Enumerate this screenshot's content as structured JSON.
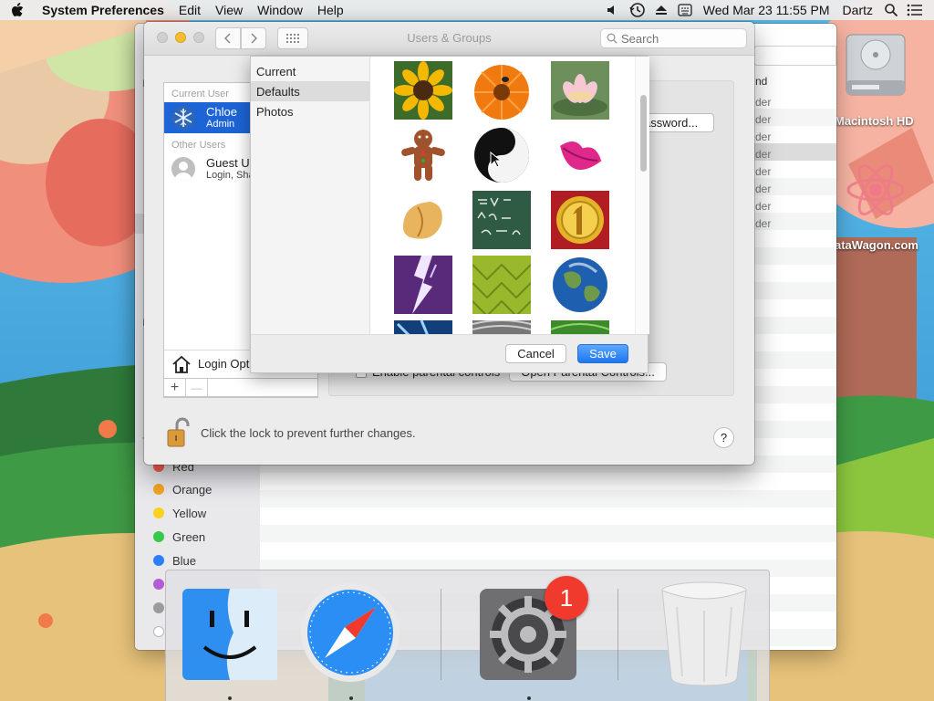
{
  "menubar": {
    "app_name": "System Preferences",
    "items": [
      "Edit",
      "View",
      "Window",
      "Help"
    ],
    "clock": "Wed Mar 23  11:55 PM",
    "user": "Dartz",
    "icons": [
      "apple-icon",
      "volume-icon",
      "time-machine-icon",
      "eject-icon",
      "keyboard-input-icon",
      "spotlight-icon",
      "notification-center-icon"
    ]
  },
  "desktop": {
    "hd_label": "Macintosh HD",
    "wagon_label": "ataWagon.com"
  },
  "finder": {
    "kind_header": "nd",
    "kind_cells": [
      "der",
      "der",
      "der",
      "der",
      "der",
      "der",
      "der",
      "der"
    ],
    "tags": [
      {
        "name": "Red",
        "color": "#fc5c52"
      },
      {
        "name": "Orange",
        "color": "#f5a623"
      },
      {
        "name": "Yellow",
        "color": "#f8d21c"
      },
      {
        "name": "Green",
        "color": "#38c94a"
      },
      {
        "name": "Blue",
        "color": "#2d7ff9"
      },
      {
        "name": "",
        "color": "#b45cd8"
      },
      {
        "name": "",
        "color": "#9b9b9b"
      },
      {
        "name": "",
        "color": "#ffffff"
      }
    ],
    "side_letters": [
      "P",
      "I",
      "T"
    ]
  },
  "prefs": {
    "title": "Users & Groups",
    "search_placeholder": "Search",
    "current_user_header": "Current User",
    "current_user_name": "Chloe",
    "current_user_role": "Admin",
    "other_users_header": "Other Users",
    "guest_name": "Guest Us",
    "guest_sub": "Login, Sha",
    "login_options": "Login Opt",
    "add_label": "+",
    "remove_label": "—",
    "password_button": "assword...",
    "parental_checkbox": "Enable parental controls",
    "parental_button": "Open Parental Controls...",
    "lock_text": "Click the lock to prevent further changes.",
    "help_label": "?"
  },
  "picker": {
    "categories": [
      "Current",
      "Defaults",
      "Photos"
    ],
    "selected_category": "Defaults",
    "pictures": [
      "sunflower",
      "orange-daisy-bee",
      "lotus",
      "gingerbread-man",
      "yin-yang",
      "lips",
      "fortune-cookie",
      "chalkboard",
      "gold-medal",
      "lightning",
      "green-leaf",
      "earth",
      "blue-ice",
      "zebra",
      "green-drops"
    ],
    "cancel_label": "Cancel",
    "save_label": "Save"
  },
  "dock": {
    "apps": [
      "Finder",
      "Safari",
      "System Preferences",
      "Trash"
    ],
    "badge_count": "1"
  },
  "colors": {
    "selection_blue": "#1d64d6",
    "save_blue": "#1e76ef",
    "badge_red": "#f03a2d"
  }
}
